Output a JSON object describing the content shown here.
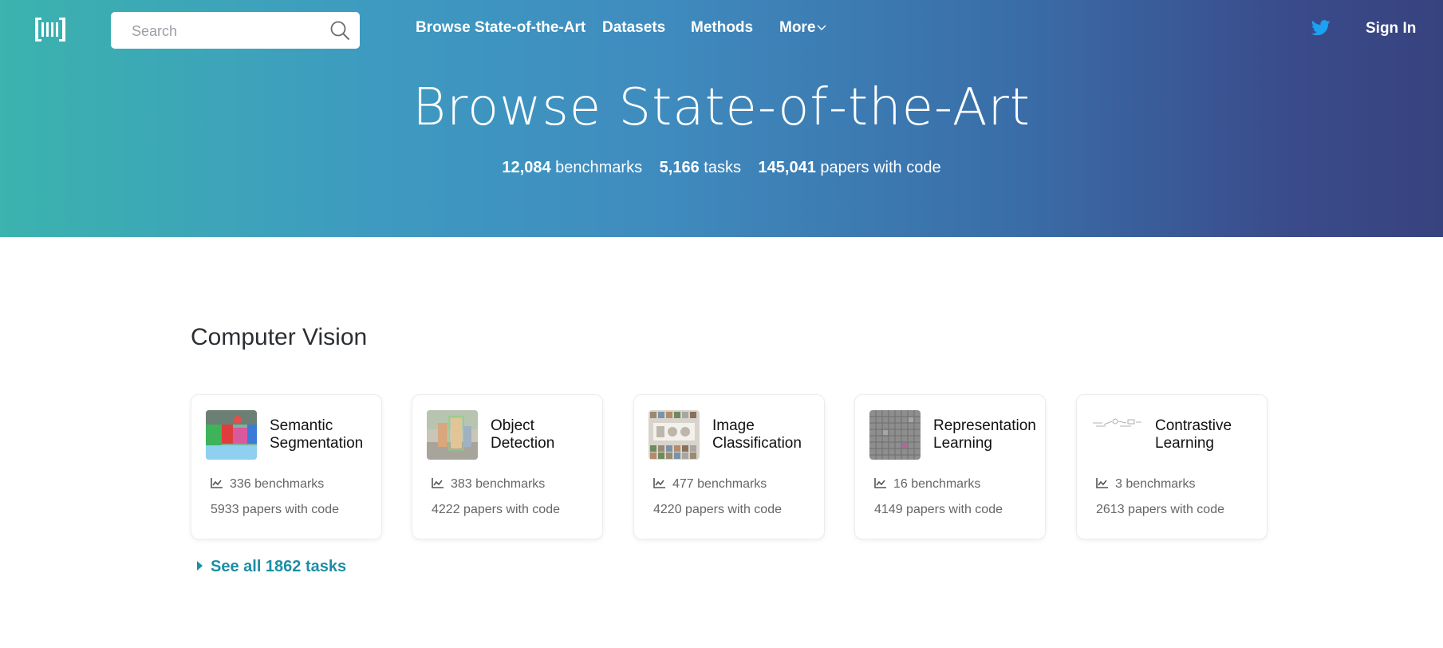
{
  "header": {
    "logo_icon": "papers-with-code-logo-icon",
    "search": {
      "placeholder": "Search",
      "value": ""
    },
    "nav": [
      {
        "label": "Browse State-of-the-Art"
      },
      {
        "label": "Datasets"
      },
      {
        "label": "Methods"
      },
      {
        "label": "More"
      }
    ],
    "twitter_icon": "twitter-icon",
    "sign_in": "Sign In"
  },
  "hero": {
    "title": "Browse State-of-the-Art",
    "stats": [
      {
        "value": "12,084",
        "label": "benchmarks"
      },
      {
        "value": "5,166",
        "label": "tasks"
      },
      {
        "value": "145,041",
        "label": "papers with code"
      }
    ]
  },
  "section": {
    "title": "Computer Vision",
    "cards": [
      {
        "title": "Semantic Segmentation",
        "benchmarks": "336 benchmarks",
        "papers": "5933 papers with code",
        "thumb": "segmentation-thumbnail"
      },
      {
        "title": "Object Detection",
        "benchmarks": "383 benchmarks",
        "papers": "4222 papers with code",
        "thumb": "detection-thumbnail"
      },
      {
        "title": "Image Classification",
        "benchmarks": "477 benchmarks",
        "papers": "4220 papers with code",
        "thumb": "classification-thumbnail"
      },
      {
        "title": "Representation Learning",
        "benchmarks": "16 benchmarks",
        "papers": "4149 papers with code",
        "thumb": "representation-thumbnail"
      },
      {
        "title": "Contrastive Learning",
        "benchmarks": "3 benchmarks",
        "papers": "2613 papers with code",
        "thumb": "contrastive-thumbnail"
      }
    ],
    "see_all": "See all 1862 tasks"
  },
  "colors": {
    "gradient_start": "#3bb3ae",
    "gradient_end": "#37437f",
    "link": "#1c8ea5",
    "twitter": "#1da1f2"
  }
}
